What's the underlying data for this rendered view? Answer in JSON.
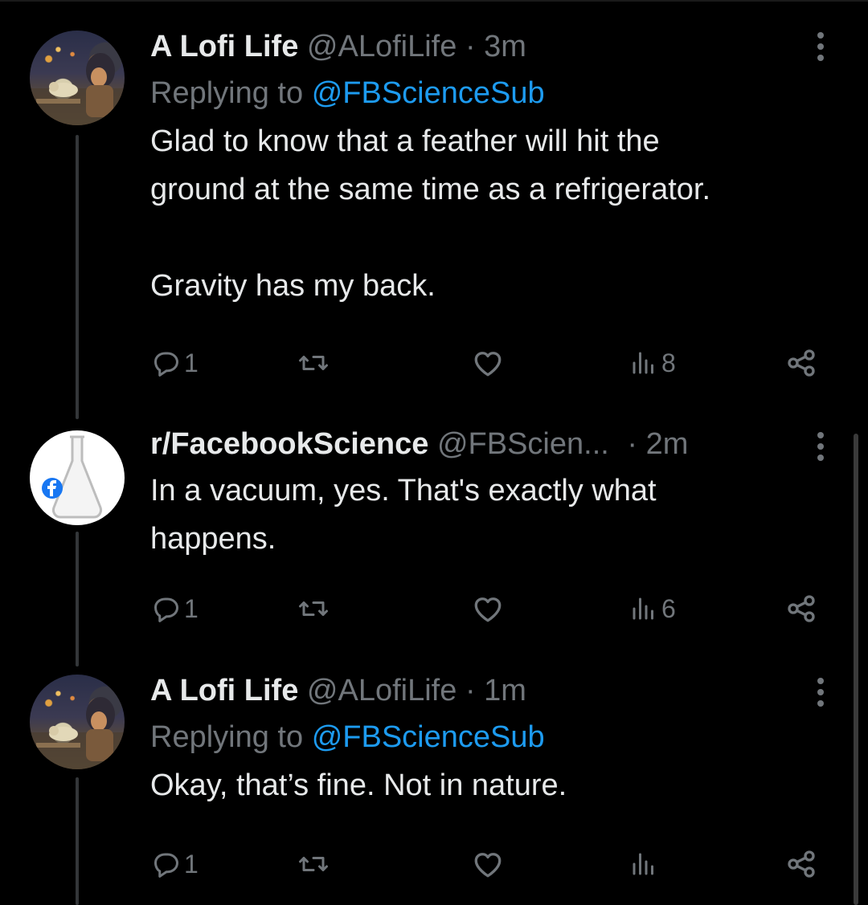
{
  "posts": [
    {
      "name": "A Lofi Life",
      "handle": "@ALofiLife",
      "time": "· 3m",
      "reply_prefix": "Replying to",
      "reply_to": "@FBScienceSub",
      "text": "Glad to know that a feather will hit the\nground at the same time as a refrigerator.\n\nGravity has my back.",
      "replies": "1",
      "views": "8"
    },
    {
      "name": "r/FacebookScience",
      "handle": "@FBScien...",
      "time": "· 2m",
      "text": "In a vacuum, yes. That's exactly what\nhappens.",
      "replies": "1",
      "views": "6"
    },
    {
      "name": "A Lofi Life",
      "handle": "@ALofiLife",
      "time": "· 1m",
      "reply_prefix": "Replying to",
      "reply_to": "@FBScienceSub",
      "text": "Okay, that’s fine.  Not in nature.",
      "replies": "1",
      "views": ""
    }
  ],
  "colors": {
    "background": "#000000",
    "text": "#e7e9ea",
    "secondary": "#71767b",
    "link": "#1d9bf0",
    "thread_line": "#333639"
  },
  "icons": [
    "reply-icon",
    "retweet-icon",
    "like-icon",
    "views-icon",
    "share-icon",
    "more-icon",
    "facebook-icon",
    "flask-icon"
  ]
}
